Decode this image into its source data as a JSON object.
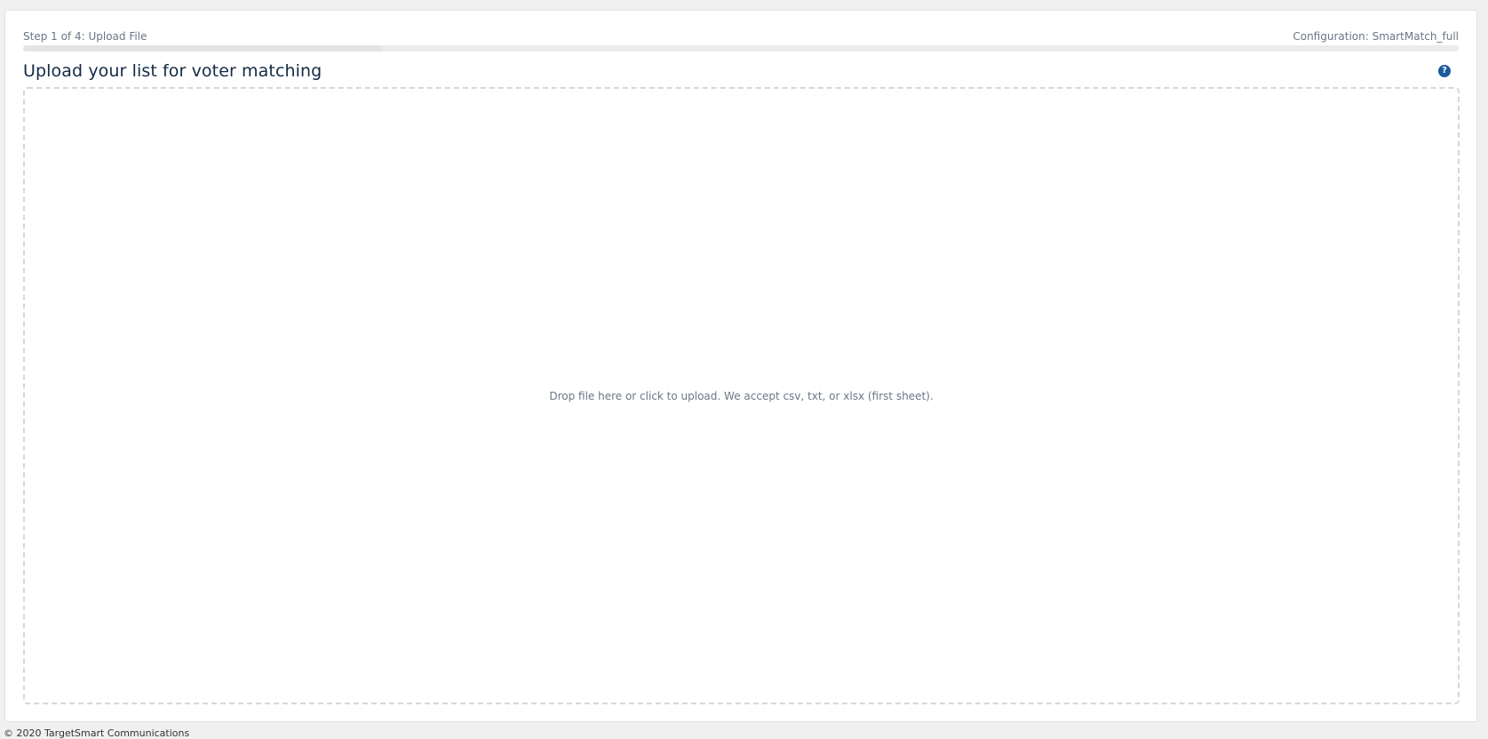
{
  "wizard": {
    "step_label": "Step 1 of 4: Upload File",
    "configuration_label": "Configuration: SmartMatch_full",
    "progress_fraction": 0.25
  },
  "page": {
    "title": "Upload your list for voter matching",
    "help_glyph": "?"
  },
  "icons": {
    "help": "question-circle-icon"
  },
  "dropzone": {
    "instructions": "Drop file here or click to upload. We accept csv, txt, or xlsx (first sheet)."
  },
  "footer": {
    "text": "© 2020 TargetSmart Communications"
  },
  "colors": {
    "accent": "#1b5a9c",
    "title": "#142a44",
    "muted_text": "#6b7685",
    "page_background": "#f0f0f0"
  }
}
